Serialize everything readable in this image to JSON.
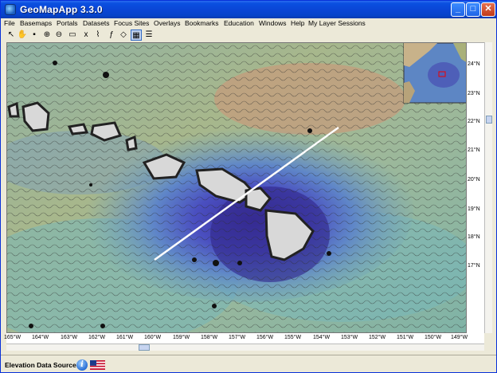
{
  "window": {
    "title": "GeoMapApp 3.3.0",
    "min_icon": "minimize-icon",
    "max_icon": "maximize-icon",
    "close_icon": "close-icon"
  },
  "menu": [
    "File",
    "Basemaps",
    "Portals",
    "Datasets",
    "Focus Sites",
    "Overlays",
    "Bookmarks",
    "Education",
    "Windows",
    "Help",
    "My Layer Sessions"
  ],
  "toolbar": {
    "tools": [
      {
        "icon": "arrow-select-icon",
        "glyph": "↖"
      },
      {
        "icon": "pan-hand-icon",
        "glyph": "✋"
      },
      {
        "icon": "save-icon",
        "glyph": "▪"
      },
      {
        "icon": "zoom-in-icon",
        "glyph": "⊕"
      },
      {
        "icon": "zoom-out-icon",
        "glyph": "⊖"
      },
      {
        "icon": "map-frame-icon",
        "glyph": "▭"
      },
      {
        "icon": "xy-plot-icon",
        "glyph": "x"
      },
      {
        "icon": "profile-tool-icon",
        "glyph": "⌇"
      },
      {
        "icon": "function-icon",
        "glyph": "ƒ"
      },
      {
        "icon": "shape-icon",
        "glyph": "◇"
      },
      {
        "icon": "grid-icon",
        "glyph": "▦"
      },
      {
        "icon": "layer-list-icon",
        "glyph": "☰"
      }
    ],
    "selected_index": 10
  },
  "map": {
    "lat_labels": [
      "24°N",
      "23°N",
      "22°N",
      "21°N",
      "20°N",
      "19°N",
      "18°N",
      "17°N"
    ],
    "lon_labels": [
      "165°W",
      "164°W",
      "163°W",
      "162°W",
      "161°W",
      "160°W",
      "159°W",
      "158°W",
      "157°W",
      "156°W",
      "155°W",
      "154°W",
      "153°W",
      "152°W",
      "151°W",
      "150°W",
      "149°W"
    ]
  },
  "status": {
    "label": "Elevation Data Sources",
    "info_icon": "info-icon",
    "flag_icon": "us-flag-icon"
  }
}
